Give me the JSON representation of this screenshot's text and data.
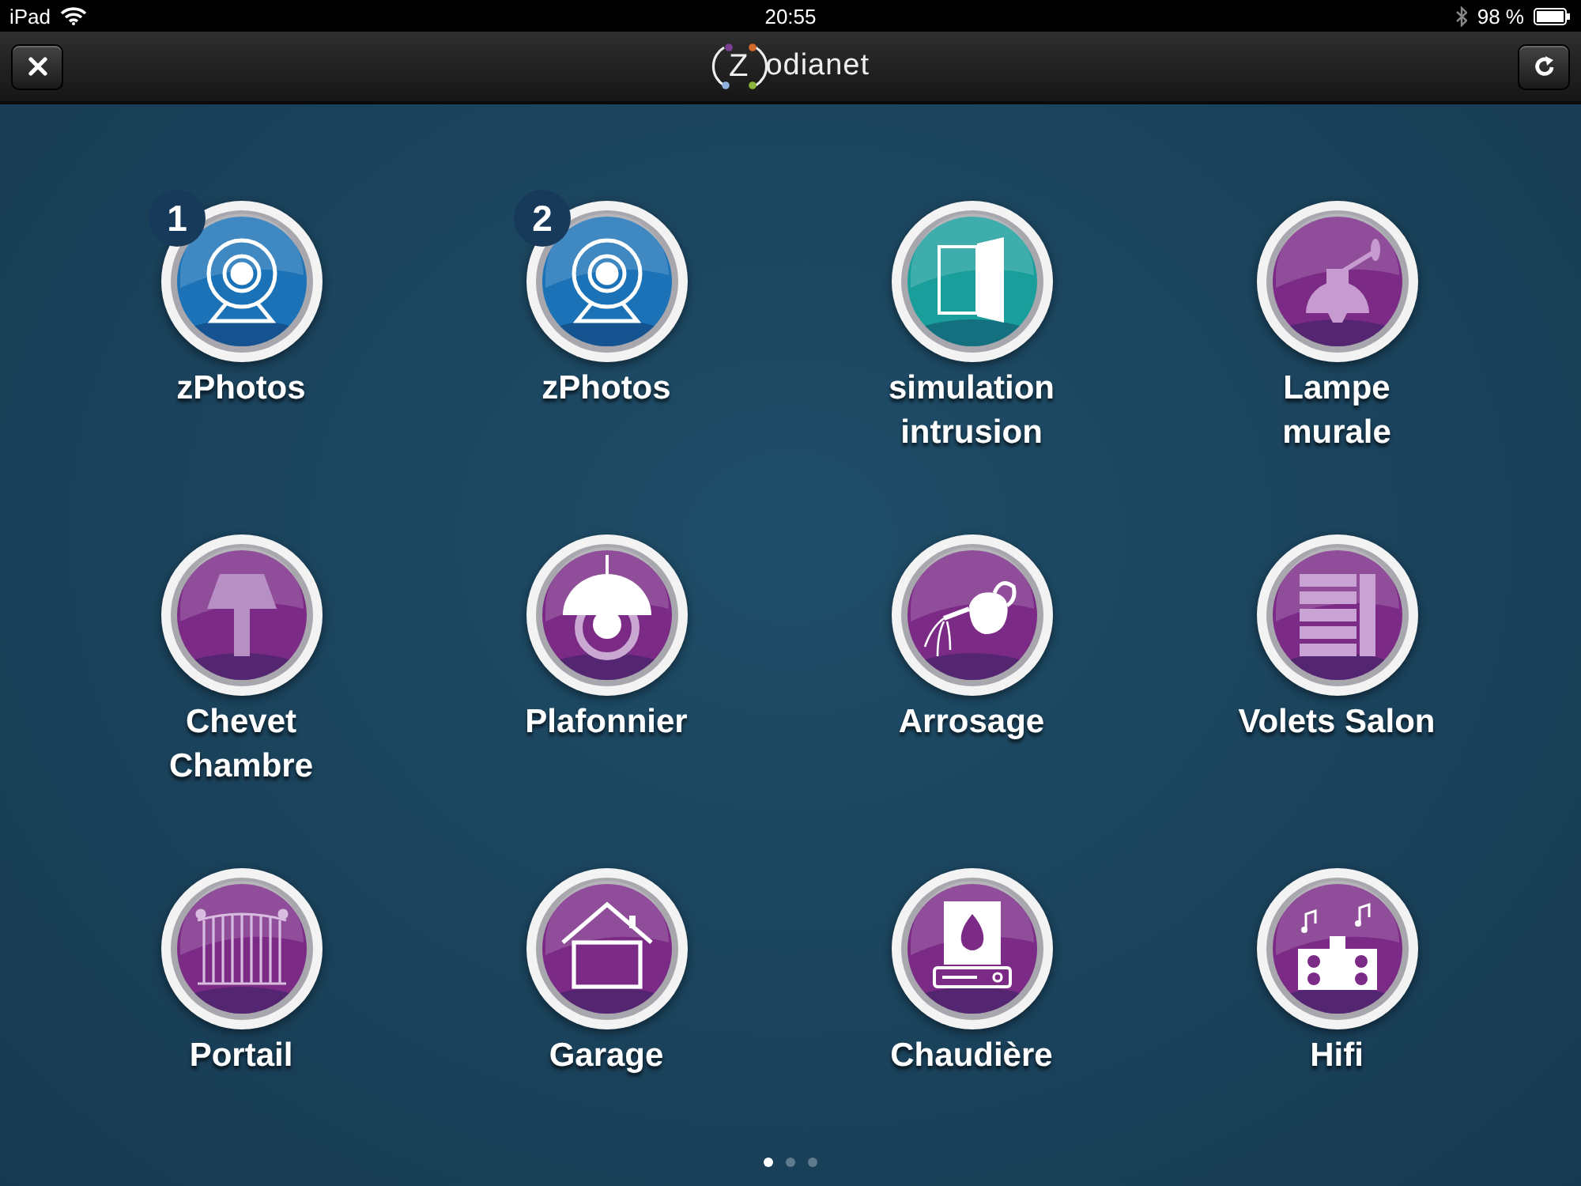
{
  "status_bar": {
    "device": "iPad",
    "time": "20:55",
    "battery": "98 %"
  },
  "header": {
    "logo_letter": "Z",
    "logo_text": "odianet"
  },
  "tiles": [
    {
      "label": "zPhotos",
      "kind": "webcam",
      "color": "#1b72b6",
      "badge": "1"
    },
    {
      "label": "zPhotos",
      "kind": "webcam",
      "color": "#1b72b6",
      "badge": "2"
    },
    {
      "label": "simulation\nintrusion",
      "kind": "door",
      "color": "#1a9e9b"
    },
    {
      "label": "Lampe\nmurale",
      "kind": "wall-lamp",
      "color": "#7b2b86"
    },
    {
      "label": "Chevet\nChambre",
      "kind": "table-lamp",
      "color": "#7b2b86"
    },
    {
      "label": "Plafonnier",
      "kind": "ceiling-lamp",
      "color": "#7b2b86"
    },
    {
      "label": "Arrosage",
      "kind": "watering-can",
      "color": "#7b2b86"
    },
    {
      "label": "Volets Salon",
      "kind": "shutter",
      "color": "#7b2b86"
    },
    {
      "label": "Portail",
      "kind": "gate",
      "color": "#7b2b86"
    },
    {
      "label": "Garage",
      "kind": "house",
      "color": "#7b2b86"
    },
    {
      "label": "Chaudière",
      "kind": "boiler",
      "color": "#7b2b86"
    },
    {
      "label": "Hifi",
      "kind": "hifi",
      "color": "#7b2b86"
    }
  ],
  "pages": [
    {
      "selected": true
    },
    {
      "selected": false
    },
    {
      "selected": false
    }
  ]
}
